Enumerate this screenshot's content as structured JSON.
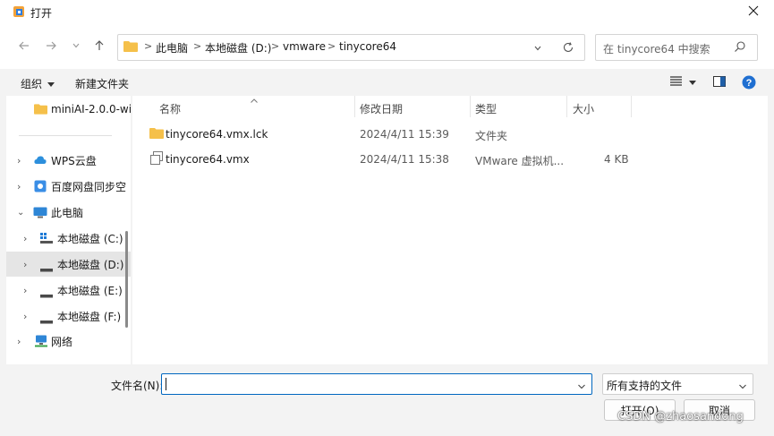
{
  "window": {
    "title": "打开"
  },
  "address": {
    "crumbs": [
      "此电脑",
      "本地磁盘 (D:)",
      "vmware",
      "tinycore64"
    ],
    "sep": ">"
  },
  "search": {
    "placeholder": "在 tinycore64 中搜索"
  },
  "toolbar": {
    "organize": "组织",
    "new_folder": "新建文件夹"
  },
  "sidebar": {
    "items": [
      {
        "label": "miniAI-2.0.0-wi"
      },
      {
        "label": "WPS云盘"
      },
      {
        "label": "百度网盘同步空"
      },
      {
        "label": "此电脑"
      },
      {
        "label": "本地磁盘 (C:)"
      },
      {
        "label": "本地磁盘 (D:)"
      },
      {
        "label": "本地磁盘 (E:)"
      },
      {
        "label": "本地磁盘 (F:)"
      },
      {
        "label": "网络"
      }
    ]
  },
  "columns": {
    "name": "名称",
    "date": "修改日期",
    "type": "类型",
    "size": "大小"
  },
  "files": [
    {
      "name": "tinycore64.vmx.lck",
      "date": "2024/4/11 15:39",
      "type": "文件夹",
      "size": ""
    },
    {
      "name": "tinycore64.vmx",
      "date": "2024/4/11 15:38",
      "type": "VMware 虚拟机...",
      "size": "4 KB"
    }
  ],
  "bottom": {
    "filename_label": "文件名(N):",
    "filename_value": "",
    "filetype": "所有支持的文件",
    "open_label": "打开(O)",
    "cancel_label": "取消"
  },
  "watermark": "CSDN @zhaosandong",
  "colors": {
    "accent": "#0067c0",
    "folder": "#f5c04a",
    "selected": "#e5e5e5"
  }
}
